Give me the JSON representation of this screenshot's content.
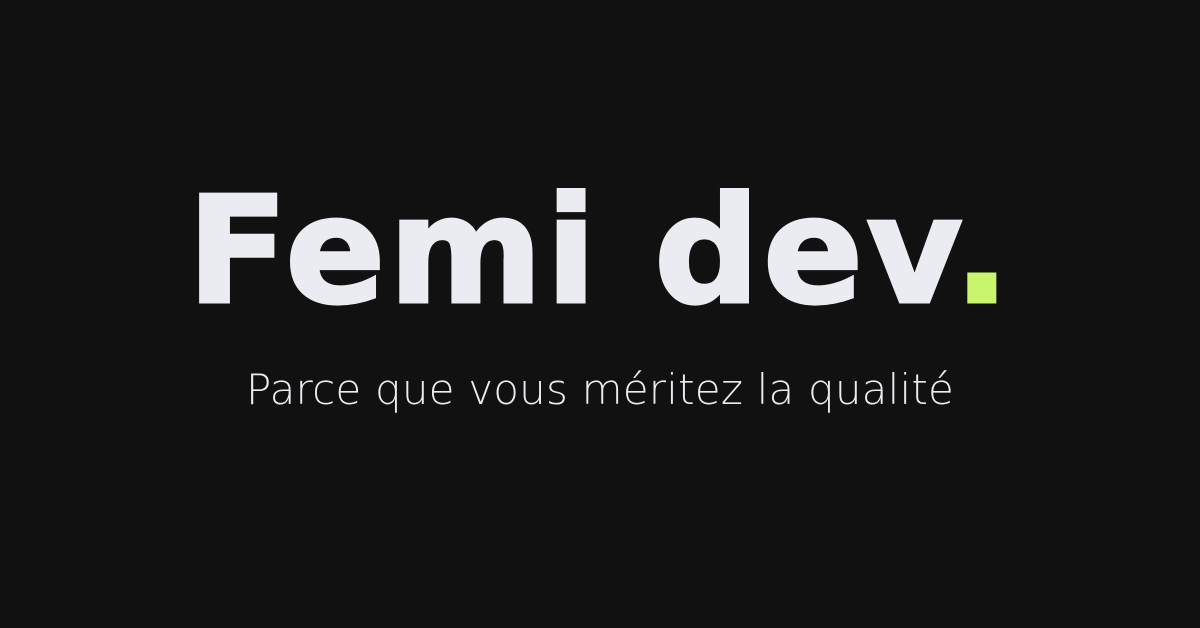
{
  "brand": {
    "name": "Femi dev",
    "dot": "."
  },
  "tagline": "Parce que vous méritez la qualité",
  "colors": {
    "background": "#111111",
    "text": "#ebebf2",
    "accent": "#c8f56b"
  }
}
